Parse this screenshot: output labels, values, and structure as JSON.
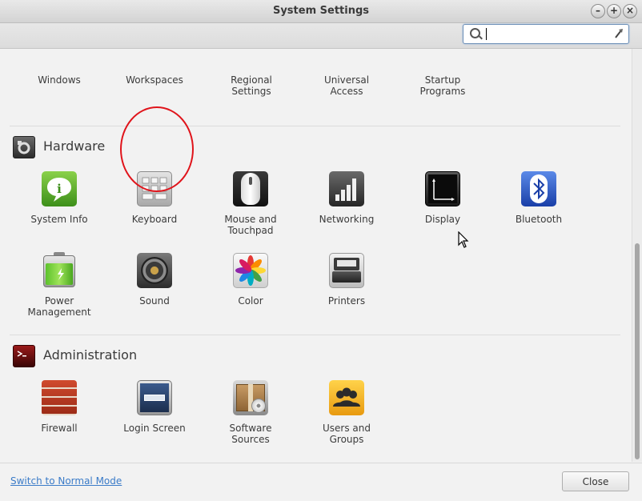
{
  "window": {
    "title": "System Settings"
  },
  "search": {
    "value": "",
    "placeholder": ""
  },
  "sections": {
    "personal_partial": [
      {
        "label": "Windows",
        "icon": "windows-icon"
      },
      {
        "label": "Workspaces",
        "icon": "workspaces-icon"
      },
      {
        "label": "Regional\nSettings",
        "icon": "regional-settings-icon"
      },
      {
        "label": "Universal\nAccess",
        "icon": "universal-access-icon"
      },
      {
        "label": "Startup\nPrograms",
        "icon": "startup-programs-icon"
      }
    ],
    "hardware": {
      "title": "Hardware",
      "items": [
        {
          "label": "System Info",
          "icon": "system-info-icon"
        },
        {
          "label": "Keyboard",
          "icon": "keyboard-icon"
        },
        {
          "label": "Mouse and\nTouchpad",
          "icon": "mouse-icon"
        },
        {
          "label": "Networking",
          "icon": "networking-icon"
        },
        {
          "label": "Display",
          "icon": "display-icon"
        },
        {
          "label": "Bluetooth",
          "icon": "bluetooth-icon"
        },
        {
          "label": "Power\nManagement",
          "icon": "battery-icon"
        },
        {
          "label": "Sound",
          "icon": "speaker-icon"
        },
        {
          "label": "Color",
          "icon": "color-icon"
        },
        {
          "label": "Printers",
          "icon": "printer-icon"
        }
      ]
    },
    "administration": {
      "title": "Administration",
      "items": [
        {
          "label": "Firewall",
          "icon": "firewall-icon"
        },
        {
          "label": "Login Screen",
          "icon": "login-screen-icon"
        },
        {
          "label": "Software\nSources",
          "icon": "software-sources-icon"
        },
        {
          "label": "Users and\nGroups",
          "icon": "users-groups-icon"
        }
      ]
    }
  },
  "footer": {
    "mode_link": "Switch to Normal Mode",
    "close_label": "Close"
  },
  "colors": {
    "annotation": "#e0141b",
    "link": "#3a7bc8"
  }
}
